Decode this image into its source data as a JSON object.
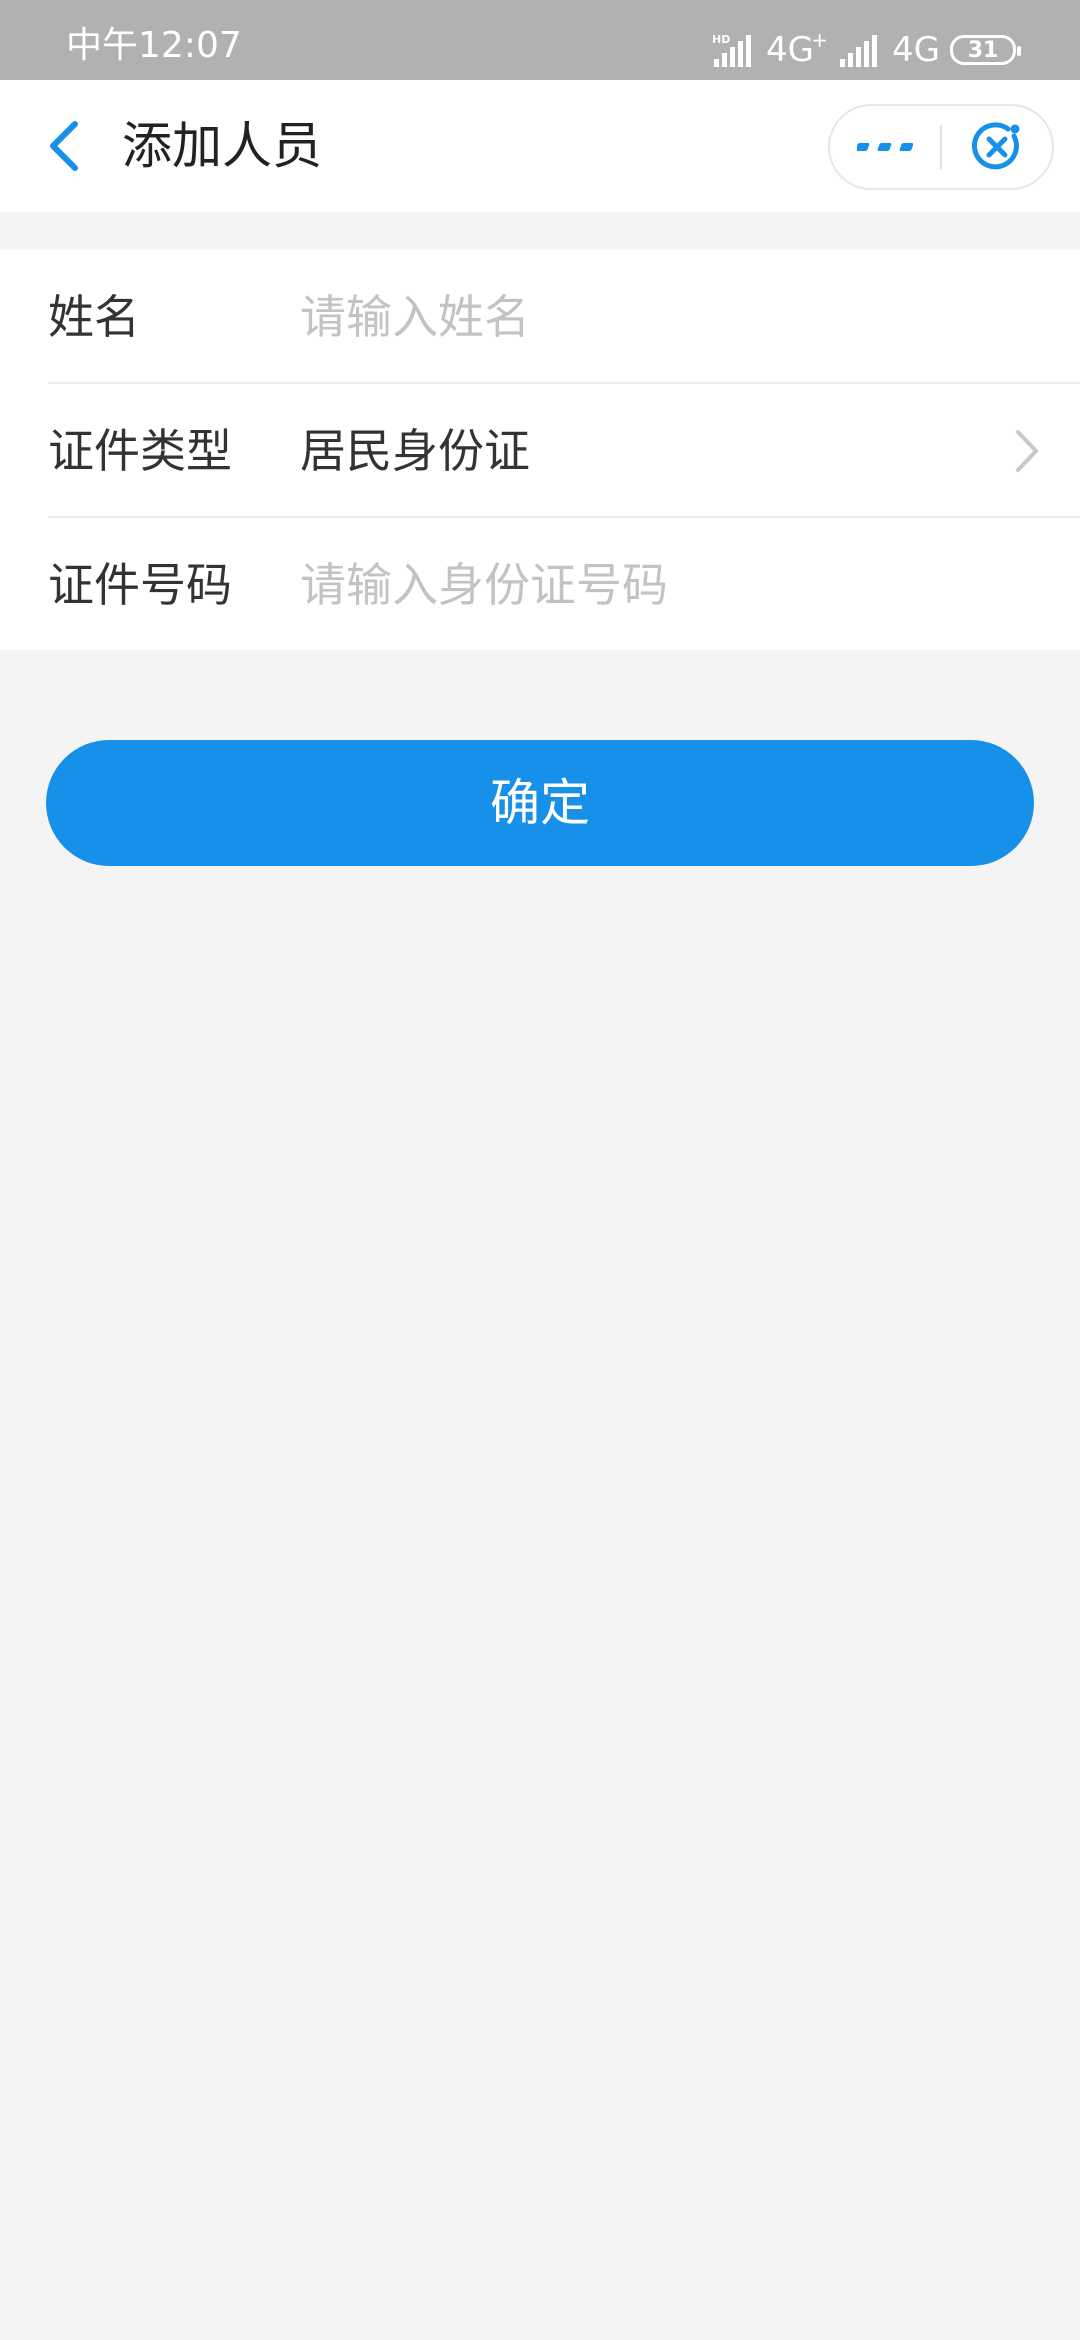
{
  "status_bar": {
    "time": "中午12:07",
    "network1": "4G",
    "network1_sup": "+",
    "network2": "4G",
    "battery": "31",
    "hd_label": "HD"
  },
  "header": {
    "title": "添加人员"
  },
  "form": {
    "name": {
      "label": "姓名",
      "placeholder": "请输入姓名",
      "value": ""
    },
    "id_type": {
      "label": "证件类型",
      "value": "居民身份证"
    },
    "id_number": {
      "label": "证件号码",
      "placeholder": "请输入身份证号码",
      "value": ""
    }
  },
  "confirm_label": "确定",
  "colors": {
    "accent": "#1690e8",
    "status_bar": "#b1b1b1",
    "background": "#f4f4f4"
  },
  "icons": {
    "back": "chevron-left-icon",
    "more": "more-dots-icon",
    "close": "close-circle-icon",
    "arrow": "chevron-right-icon"
  }
}
